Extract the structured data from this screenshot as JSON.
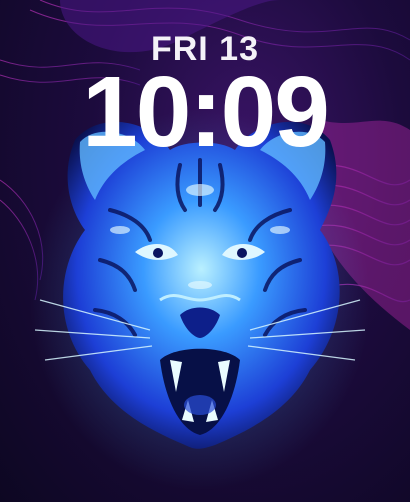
{
  "lock_screen": {
    "date": "FRI 13",
    "time": "10:09",
    "wallpaper": {
      "subject": "tiger-face-icon",
      "colors": {
        "background": "#1c0b3d",
        "wave": "#c42bd0",
        "tiger": "#2a7dff",
        "glow": "#9fe4ff"
      }
    }
  }
}
